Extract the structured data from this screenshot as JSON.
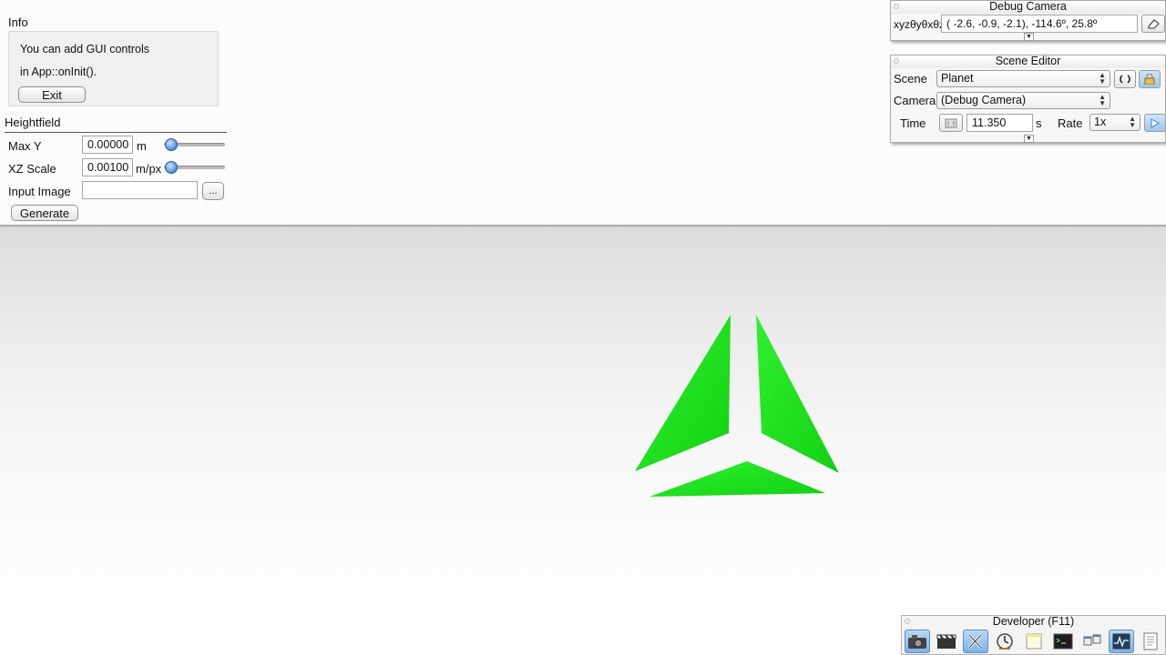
{
  "info_panel": {
    "title": "Info",
    "line1": "You can add GUI controls",
    "line2": "in App::onInit().",
    "exit_label": "Exit"
  },
  "heightfield": {
    "title": "Heightfield",
    "max_y": {
      "label": "Max Y",
      "value": "0.00000",
      "unit": "m",
      "slider": 0.0
    },
    "xz_scale": {
      "label": "XZ Scale",
      "value": "0.00100",
      "unit": "m/px",
      "slider": 0.0
    },
    "input_image": {
      "label": "Input Image",
      "value": "",
      "browse_label": "..."
    },
    "generate_label": "Generate"
  },
  "debug_camera": {
    "title": "Debug Camera",
    "label": "xyzθyθxθz",
    "value": "( -2.6,  -0.9,  -2.1), -114.6º,  25.8º"
  },
  "scene_editor": {
    "title": "Scene Editor",
    "scene_label": "Scene",
    "scene_value": "Planet",
    "camera_label": "Camera",
    "camera_value": "(Debug Camera)",
    "time_label": "Time",
    "time_value": "11.350",
    "time_unit": "s",
    "rate_label": "Rate",
    "rate_value": "1x"
  },
  "developer": {
    "title": "Developer (F11)",
    "tools": [
      "camera-icon",
      "clapperboard-icon",
      "tools-icon",
      "clock-icon",
      "note-icon",
      "terminal-icon",
      "windows-icon",
      "profiler-icon",
      "document-icon"
    ]
  },
  "colors": {
    "model_green": "#1ee01e",
    "slider_blue": "#4e8fd8"
  }
}
